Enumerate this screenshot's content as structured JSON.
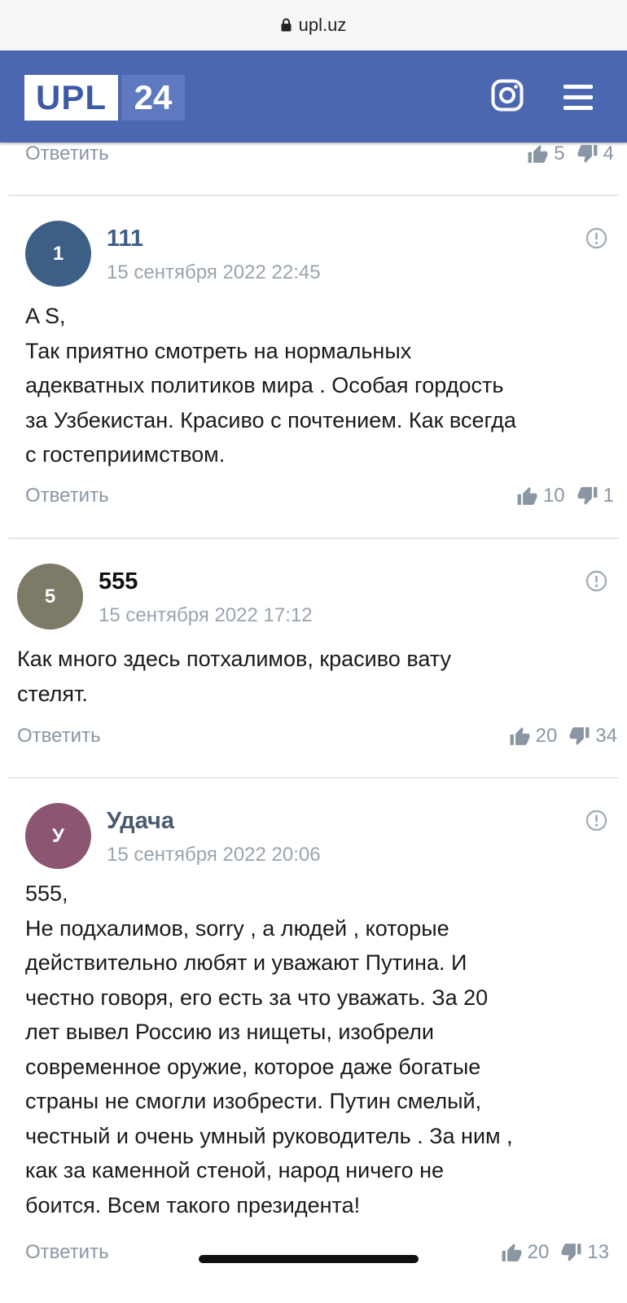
{
  "browser": {
    "url": "upl.uz"
  },
  "header": {
    "logo_left": "UPL",
    "logo_right": "24"
  },
  "previous": {
    "reply_label": "Ответить",
    "likes": "5",
    "dislikes": "4"
  },
  "comments": [
    {
      "avatar_letter": "1",
      "avatar_color": "#3d5f86",
      "author": "111",
      "author_color": "#3d5f86",
      "date": "15 сентября 2022 22:45",
      "lines": [
        "A S,",
        "Так приятно смотреть на нормальных",
        "адекватных политиков мира . Особая гордость",
        "за Узбекистан. Красиво с почтением. Как всегда",
        "с гостеприимством."
      ],
      "reply_label": "Ответить",
      "likes": "10",
      "dislikes": "1"
    },
    {
      "avatar_letter": "5",
      "avatar_color": "#7d7a67",
      "author": "555",
      "author_color": "#111111",
      "date": "15 сентября 2022 17:12",
      "lines": [
        "Как много здесь потхалимов, красиво вату",
        "стелят."
      ],
      "reply_label": "Ответить",
      "likes": "20",
      "dislikes": "34"
    },
    {
      "avatar_letter": "У",
      "avatar_color": "#8c5672",
      "author": "Удача",
      "author_color": "#4a5a70",
      "date": "15 сентября 2022 20:06",
      "lines": [
        "555,",
        "Не подхалимов, sorry , а людей , которые",
        "действительно любят и уважают Путина. И",
        "честно говоря, его есть за что уважать. За 20",
        "лет вывел Россию из нищеты, изобрели",
        "современное оружие, которое даже богатые",
        "страны не смогли изобрести. Путин смелый,",
        "честный и очень умный руководитель . За ним ,",
        "как за каменной стеной, народ ничего не",
        "боится. Всем такого президента!"
      ],
      "reply_label": "Ответить",
      "likes": "20",
      "dislikes": "13"
    }
  ]
}
